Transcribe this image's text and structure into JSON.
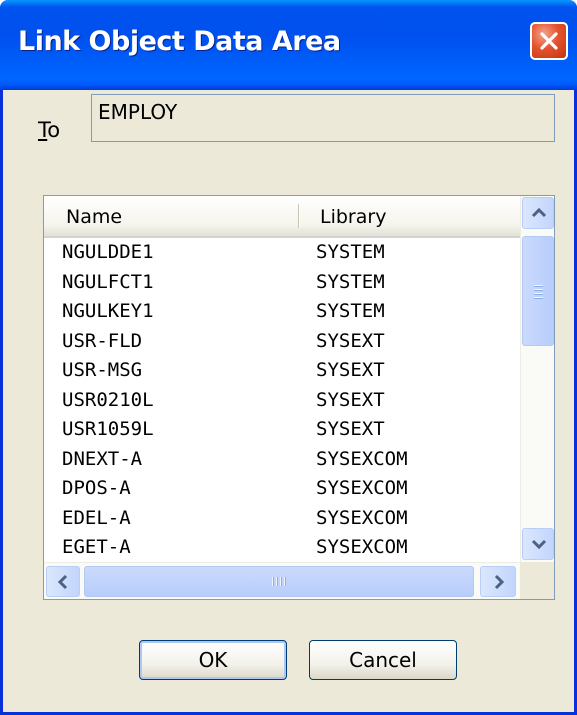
{
  "window": {
    "title": "Link Object Data Area"
  },
  "to": {
    "label_underlined": "T",
    "label_rest": "o",
    "value": "EMPLOY"
  },
  "list": {
    "columns": [
      "Name",
      "Library"
    ],
    "rows": [
      [
        "NGULDDE1",
        "SYSTEM"
      ],
      [
        "NGULFCT1",
        "SYSTEM"
      ],
      [
        "NGULKEY1",
        "SYSTEM"
      ],
      [
        "USR-FLD",
        "SYSEXT"
      ],
      [
        "USR-MSG",
        "SYSEXT"
      ],
      [
        "USR0210L",
        "SYSEXT"
      ],
      [
        "USR1059L",
        "SYSEXT"
      ],
      [
        "DNEXT-A",
        "SYSEXCOM"
      ],
      [
        "DPOS-A",
        "SYSEXCOM"
      ],
      [
        "EDEL-A",
        "SYSEXCOM"
      ],
      [
        "EGET-A",
        "SYSEXCOM"
      ]
    ]
  },
  "buttons": {
    "ok": "OK",
    "cancel": "Cancel"
  },
  "icons": {
    "close": "close-icon",
    "scroll_up": "arrow-up-icon",
    "scroll_down": "arrow-down-icon",
    "scroll_left": "arrow-left-icon",
    "scroll_right": "arrow-right-icon"
  },
  "colors": {
    "titlebar": "#0053ee",
    "window_bg": "#ece9d8",
    "close_button": "#e3532f",
    "scrollbar": "#c2d5fc"
  }
}
